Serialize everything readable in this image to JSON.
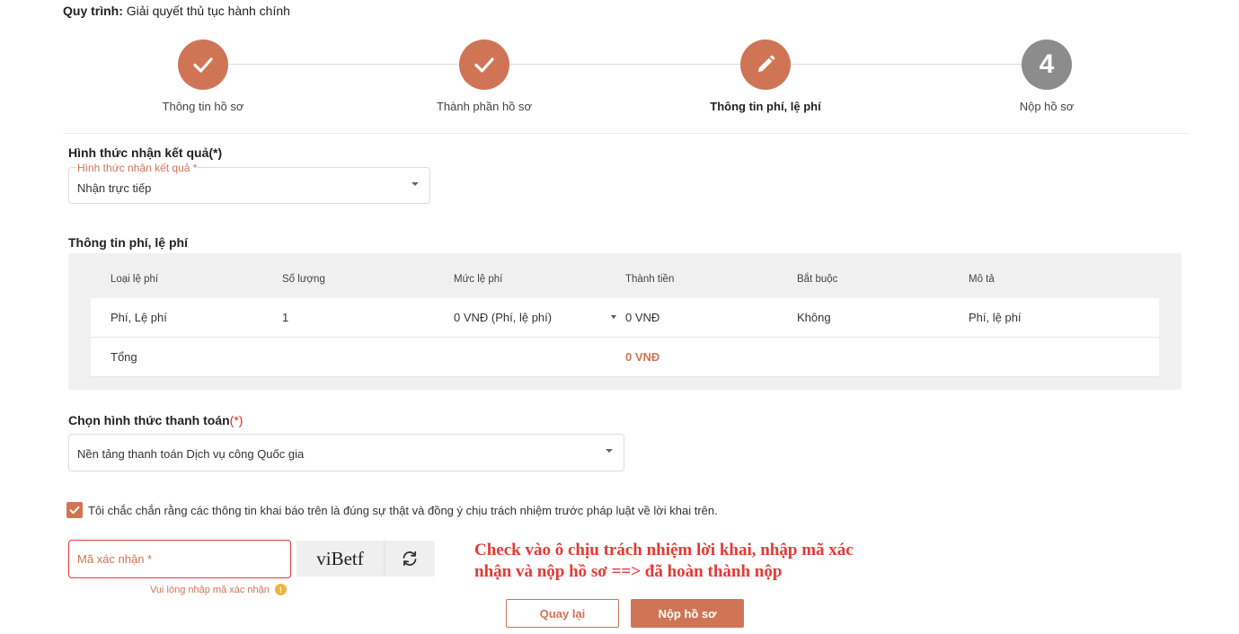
{
  "process": {
    "label": "Quy trình:",
    "name": "Giải quyết thủ tục hành chính"
  },
  "steps": [
    {
      "label": "Thông tin hồ sơ",
      "state": "done"
    },
    {
      "label": "Thành phần hồ sơ",
      "state": "done"
    },
    {
      "label": "Thông tin phí, lệ phí",
      "state": "active"
    },
    {
      "label": "Nộp hồ sơ",
      "state": "pending",
      "number": "4"
    }
  ],
  "result_method": {
    "title": "Hình thức nhận kết quả(*)",
    "field_label": "Hình thức nhận kết quả *",
    "value": "Nhận trực tiếp"
  },
  "fees": {
    "title": "Thông tin phí, lệ phí",
    "headers": [
      "Loại lệ phí",
      "Số lượng",
      "Mức lệ phí",
      "Thành tiền",
      "Bắt buộc",
      "Mô tả"
    ],
    "rows": [
      [
        "Phí, Lệ phí",
        "1",
        "0 VNĐ (Phí, lệ phí)",
        "0 VNĐ",
        "Không",
        "Phí, lệ phí"
      ]
    ],
    "total_label": "Tổng",
    "total_value": "0 VNĐ"
  },
  "payment": {
    "title": "Chọn hình thức thanh toán",
    "required_mark": "(*)",
    "value": "Nền tảng thanh toán Dịch vụ công Quốc gia"
  },
  "consent": {
    "checked": true,
    "text": "Tôi chắc chắn rằng các thông tin khai báo trên là đúng sự thật và đồng ý chịu trách nhiệm trước pháp luật về lời khai trên."
  },
  "captcha": {
    "placeholder": "Mã xác nhận *",
    "code": "viBetf",
    "error": "Vui lòng nhập mã xác nhận",
    "warn_symbol": "!"
  },
  "annotation": {
    "line1": "Check vào ô chịu trách nhiệm lời khai, nhập mã xác",
    "line2": "nhận và nộp hồ sơ ==> đã hoàn thành nộp"
  },
  "buttons": {
    "back": "Quay lại",
    "submit": "Nộp hồ sơ"
  },
  "colors": {
    "accent": "#cf7556",
    "pending": "#8c8c8c",
    "error": "#e53935",
    "panel": "#f0f0f0"
  }
}
